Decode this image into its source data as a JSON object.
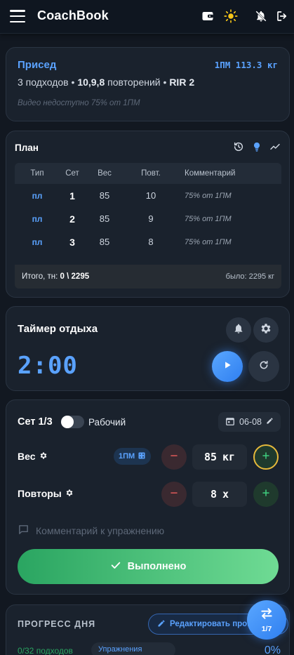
{
  "app": {
    "title": "CoachBook"
  },
  "exercise": {
    "name": "Присед",
    "one_rm": "1ПМ 113.3 кг",
    "summary_prefix": "3 подходов • ",
    "summary_reps": "10,9,8",
    "summary_mid": " повторений • ",
    "summary_rir": "RIR 2",
    "note": "Видео недоступно   75% от 1ПМ"
  },
  "plan": {
    "title": "План",
    "headers": {
      "type": "Тип",
      "set": "Сет",
      "weight": "Вес",
      "reps": "Повт.",
      "comment": "Комментарий"
    },
    "rows": [
      {
        "type": "пл",
        "set": "1",
        "weight": "85",
        "reps": "10",
        "comment": "75% от 1ПМ"
      },
      {
        "type": "пл",
        "set": "2",
        "weight": "85",
        "reps": "9",
        "comment": "75% от 1ПМ"
      },
      {
        "type": "пл",
        "set": "3",
        "weight": "85",
        "reps": "8",
        "comment": "75% от 1ПМ"
      }
    ],
    "total_label": "Итого, тн: ",
    "total_value": "0 \\ 2295",
    "was": "было: 2295 кг"
  },
  "timer": {
    "title": "Таймер отдыха",
    "value": "2:00"
  },
  "set": {
    "label": "Сет 1/3",
    "toggle_label": "Рабочий",
    "date": "06-08",
    "weight_label": "Вес",
    "rm_chip": "1ПМ",
    "weight_value": "85",
    "weight_unit": "кг",
    "reps_label": "Повторы",
    "reps_value": "8",
    "reps_unit": "x",
    "comment_placeholder": "Комментарий к упражнению",
    "done_label": "Выполнено"
  },
  "progress": {
    "title": "ПРОГРЕСС ДНЯ",
    "edit_label": "Редактировать прогр",
    "sets_done": "0/32 подходов",
    "ex_chip": "Упражнения",
    "percent": "0%"
  },
  "fab": {
    "count": "1/7"
  },
  "colors": {
    "accent": "#5aa2ff",
    "success": "#2aa561",
    "danger": "#e05a5a",
    "focus_ring": "#e6b93b"
  }
}
